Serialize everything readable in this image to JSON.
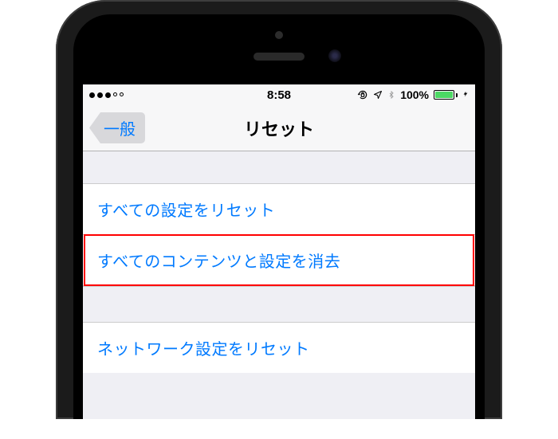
{
  "status": {
    "time": "8:58",
    "battery_pct": "100%"
  },
  "nav": {
    "back_label": "一般",
    "title": "リセット"
  },
  "rows": {
    "reset_all_settings": "すべての設定をリセット",
    "erase_all_content": "すべてのコンテンツと設定を消去",
    "reset_network": "ネットワーク設定をリセット"
  }
}
